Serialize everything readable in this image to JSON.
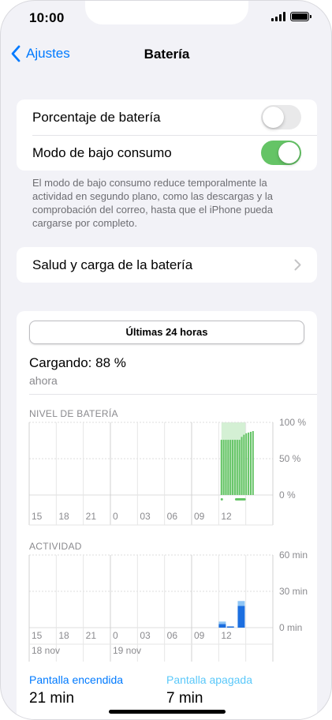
{
  "status": {
    "time": "10:00"
  },
  "nav": {
    "back_label": "Ajustes",
    "title": "Batería"
  },
  "settings": {
    "battery_percentage_label": "Porcentaje de batería",
    "battery_percentage_on": false,
    "low_power_label": "Modo de bajo consumo",
    "low_power_on": true,
    "footnote": "El modo de bajo consumo reduce temporalmente la actividad en segundo plano, como las descargas y la comprobación del correo, hasta que el iPhone pueda cargarse por completo.",
    "health_label": "Salud y carga de la batería"
  },
  "usage": {
    "period_label": "Últimas 24 horas",
    "charging_label": "Cargando: 88 %",
    "charging_time": "ahora",
    "screen_on_label": "Pantalla encendida",
    "screen_on_value": "21 min",
    "screen_off_label": "Pantalla apagada",
    "screen_off_value": "7 min"
  },
  "colors": {
    "accent": "#007aff",
    "battery_green": "#65c466",
    "charging_band": "#d4f0d4",
    "activity_dark": "#1c6fe0",
    "activity_light": "#8ec5f5"
  },
  "chart_data": [
    {
      "type": "bar",
      "title": "NIVEL DE BATERÍA",
      "x": [
        "15",
        "18",
        "21",
        "0",
        "03",
        "06",
        "09",
        "12"
      ],
      "y_ticks": [
        "100 %",
        "50 %",
        "0 %"
      ],
      "ylim": [
        0,
        100
      ],
      "bar_start_hour": 12.3,
      "bar_step_hours": 0.25,
      "values": [
        76,
        76,
        76,
        76,
        76,
        76,
        76,
        76,
        76,
        80,
        83,
        85,
        86,
        87,
        88
      ],
      "charging_from_hour": 12.3,
      "charging_to_hour": 15.0
    },
    {
      "type": "bar",
      "title": "ACTIVIDAD",
      "x": [
        "15",
        "18",
        "21",
        "0",
        "03",
        "06",
        "09",
        "12"
      ],
      "date_labels": [
        "18 nov",
        "19 nov"
      ],
      "y_ticks": [
        "60 min",
        "30 min",
        "0 min"
      ],
      "ylim": [
        0,
        60
      ],
      "series": [
        {
          "name": "Pantalla encendida",
          "values": [
            {
              "hour": 12.4,
              "min": 3
            },
            {
              "hour": 13.3,
              "min": 1
            },
            {
              "hour": 14.5,
              "min": 18
            }
          ]
        },
        {
          "name": "Pantalla apagada",
          "values": [
            {
              "hour": 12.4,
              "min": 2
            },
            {
              "hour": 13.3,
              "min": 0
            },
            {
              "hour": 14.5,
              "min": 4
            }
          ]
        }
      ]
    }
  ]
}
